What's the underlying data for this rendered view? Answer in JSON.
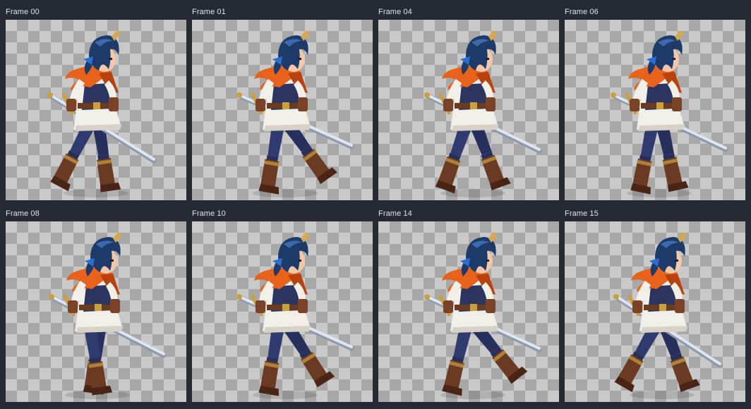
{
  "frames": [
    {
      "label": "Frame 00",
      "pose": "front-foot-forward",
      "colors": {
        "hair": "#1d3a68",
        "scarf": "#e8621c",
        "boots": "#6b3a22",
        "legs": "#27305c",
        "vest": "#2c3560",
        "blade": "#dfe6f0"
      }
    },
    {
      "label": "Frame 01",
      "pose": "back-foot-lift"
    },
    {
      "label": "Frame 04",
      "pose": "mid-stride"
    },
    {
      "label": "Frame 06",
      "pose": "passing"
    },
    {
      "label": "Frame 08",
      "pose": "passing-low"
    },
    {
      "label": "Frame 10",
      "pose": "back-foot-lift"
    },
    {
      "label": "Frame 14",
      "pose": "back-foot-lift-wide"
    },
    {
      "label": "Frame 15",
      "pose": "contact-wide"
    }
  ],
  "palette": {
    "hair": "#1d3a68",
    "hair_hi": "#3b6ab0",
    "skin": "#f3c7a8",
    "scarf": "#e8621c",
    "scarf_dark": "#b8420e",
    "blouse": "#f2efe8",
    "vest": "#2c3560",
    "belt": "#6a3b1f",
    "legs": "#27305c",
    "boots": "#6b3a22",
    "boots_dark": "#4a2414",
    "glove": "#7a4226",
    "blade": "#dfe6f0",
    "blade_edge": "#8c98ad",
    "hilt": "#c9a040",
    "ribbon": "#2a6fd0",
    "horn": "#d8a84a"
  }
}
